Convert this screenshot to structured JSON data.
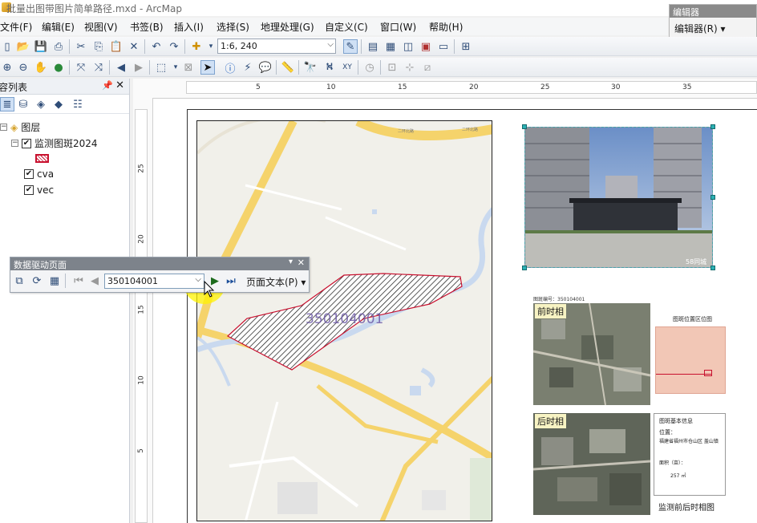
{
  "window": {
    "title": "批量出图带图片简单路径.mxd - ArcMap"
  },
  "menubar": {
    "items": [
      "文件(F)",
      "编辑(E)",
      "视图(V)",
      "书签(B)",
      "插入(I)",
      "选择(S)",
      "地理处理(G)",
      "自定义(C)",
      "窗口(W)",
      "帮助(H)"
    ]
  },
  "editor_toolbar": {
    "title": "编辑器",
    "button": "编辑器(R) ▾"
  },
  "toolbar": {
    "scale": "1:6, 240"
  },
  "toc": {
    "title": "内容列表",
    "layers_group": "图层",
    "layers": [
      {
        "name": "监测图斑2024",
        "checked": true
      },
      {
        "name": "cva",
        "checked": true
      },
      {
        "name": "vec",
        "checked": true
      }
    ]
  },
  "ruler": {
    "h_ticks": [
      "5",
      "10",
      "15",
      "20",
      "25",
      "30",
      "35"
    ],
    "v_ticks": [
      "25",
      "20",
      "15",
      "10",
      "5"
    ]
  },
  "ddp": {
    "title": "数据驱动页面",
    "current_page": "350104001",
    "page_text": "页面文本(P) ▾"
  },
  "map": {
    "parcel_label": "350104001",
    "road_labels": [
      "二环北路",
      "二环北路"
    ]
  },
  "layout": {
    "patch_no_label": "图斑编号：350104001",
    "before_label": "前时相",
    "after_label": "后时相",
    "location_title": "图斑位置区位图",
    "info_title": "图斑基本信息",
    "info_location_label": "位置：",
    "info_location_value": "福建省福州市仓山区 盖山镇",
    "info_area_label": "面积（亩）：",
    "info_area_value": "257 ㎡",
    "caption": "监测前后时相图",
    "photo_watermark": "58同城"
  },
  "colors": {
    "parcel_outline": "#c8102e",
    "highlight": "#fff200",
    "road": "#f5d36b"
  }
}
